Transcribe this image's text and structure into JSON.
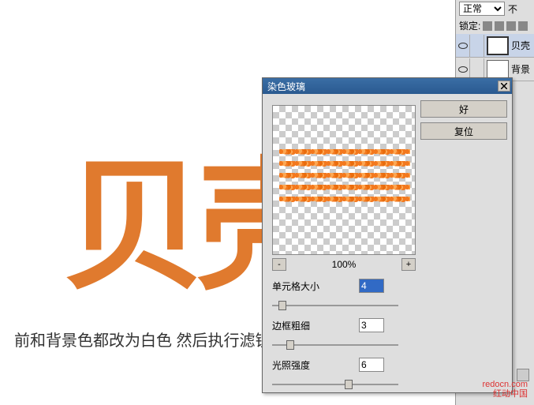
{
  "canvas": {
    "text": "贝壳"
  },
  "caption": "前和背景色都改为白色 然后执行滤镜 纹理 染色玻璃 设置如图",
  "watermark": {
    "l1": "redocn.com",
    "l2": "红动中国"
  },
  "layers": {
    "mode": "正常",
    "extra": "不",
    "lock_label": "锁定:",
    "rows": [
      {
        "name": "贝壳",
        "selected": true
      },
      {
        "name": "背景",
        "selected": false
      }
    ]
  },
  "dialog": {
    "title": "染色玻璃",
    "ok": "好",
    "reset": "复位",
    "zoom": "100%",
    "controls": [
      {
        "label": "单元格大小",
        "value": "4",
        "hl": true,
        "thumb": 8
      },
      {
        "label": "边框粗细",
        "value": "3",
        "hl": false,
        "thumb": 18
      },
      {
        "label": "光照强度",
        "value": "6",
        "hl": false,
        "thumb": 92
      }
    ]
  }
}
